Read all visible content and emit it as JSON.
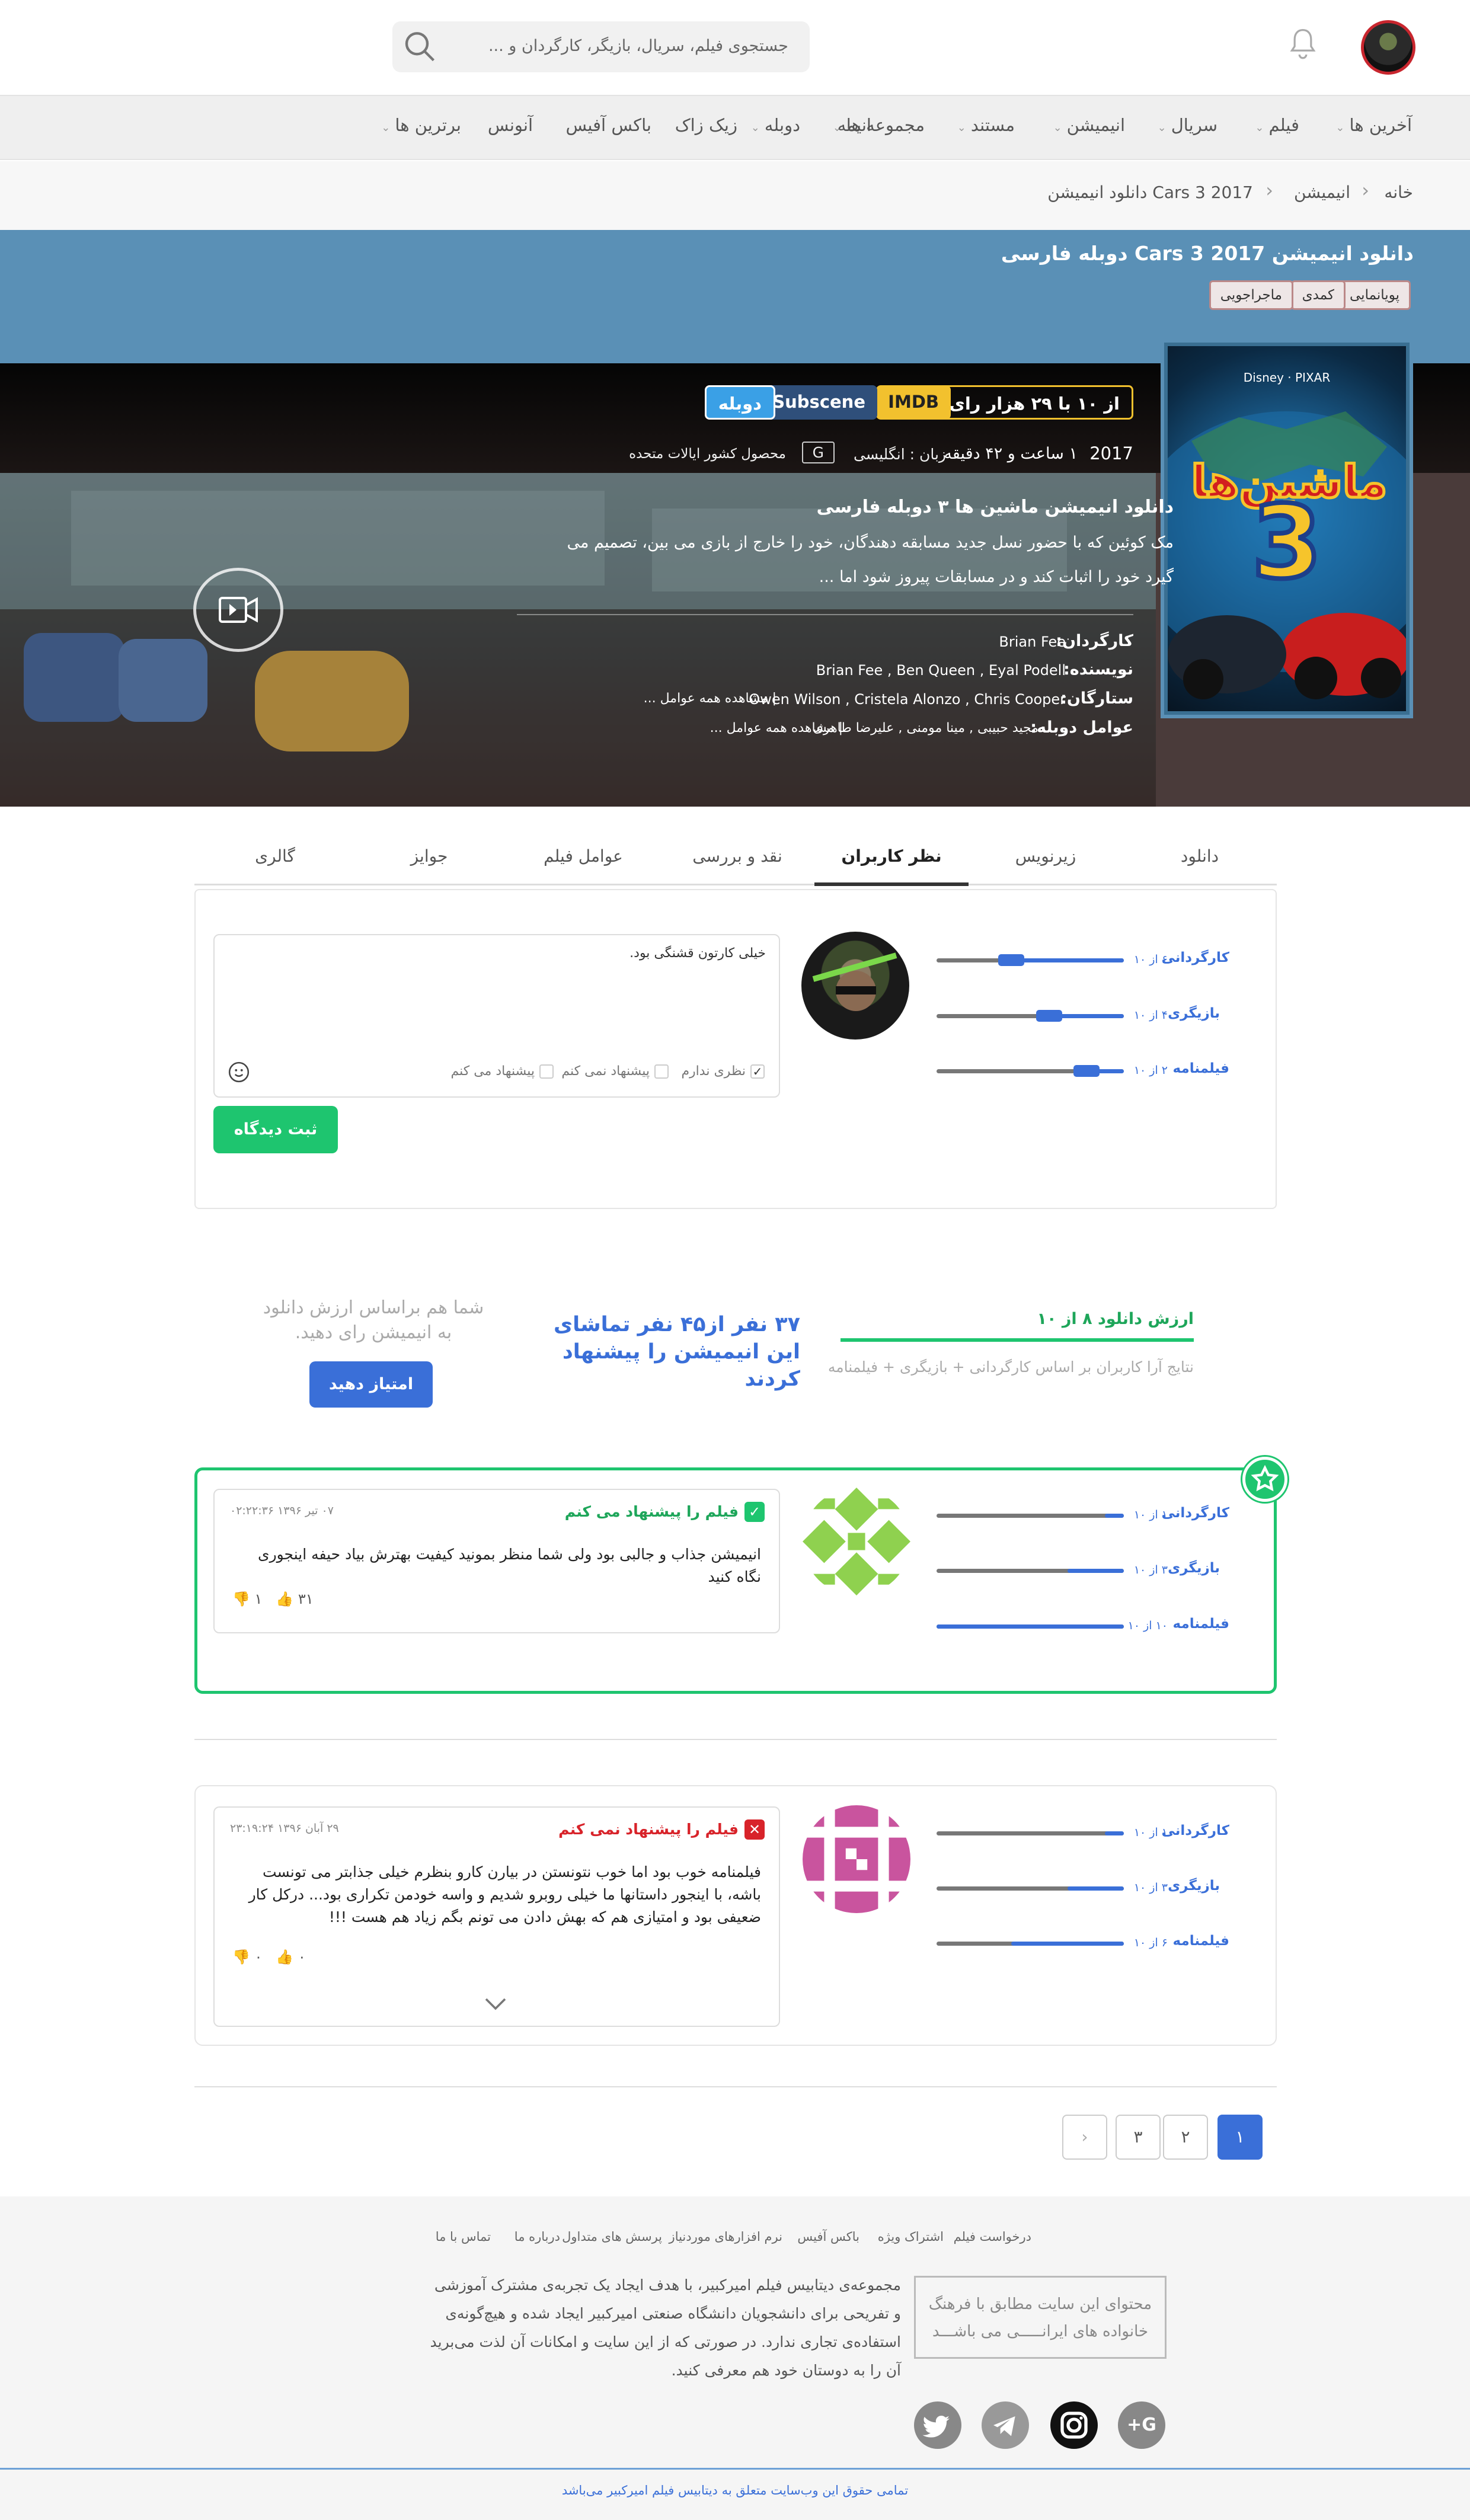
{
  "header": {
    "search_placeholder": "جستجوی فیلم، سریال، بازیگر، کارگردان و ..."
  },
  "nav": [
    {
      "label": "آخرین ها",
      "dropdown": true
    },
    {
      "label": "فیلم",
      "dropdown": true
    },
    {
      "label": "سریال",
      "dropdown": true
    },
    {
      "label": "انیمیشن",
      "dropdown": true
    },
    {
      "label": "مستند",
      "dropdown": true
    },
    {
      "label": "مجموعه ها",
      "dropdown": true
    },
    {
      "label": "انیمه",
      "dropdown": false
    },
    {
      "label": "دوبله",
      "dropdown": true
    },
    {
      "label": "زیک زاک",
      "dropdown": false
    },
    {
      "label": "باکس آفیس",
      "dropdown": false
    },
    {
      "label": "آنونس",
      "dropdown": false
    },
    {
      "label": "برترین ها",
      "dropdown": true
    }
  ],
  "breadcrumb": [
    "خانه",
    "انیمیشن",
    "دانلود انیمیشن Cars 3 2017"
  ],
  "movie": {
    "title": "دانلود انیمیشن Cars 3 2017  دوبله فارسی",
    "genres": [
      "پویانمایی",
      "کمدی",
      "ماجراجویی"
    ],
    "rating": "۶.۹ از ۱۰ با ۲۹ هزار رای",
    "imdb": "IMDB",
    "subscene": "Subscene",
    "dub": "دوبله",
    "year": "2017",
    "duration": "۱ ساعت و ۴۲ دقیقه",
    "language": "زبان : انگلیسی",
    "age": "G",
    "country": "محصول کشور ایالات متحده",
    "synopsis_title": "دانلود انیمیشن ماشین ها ۳ دوبله فارسی",
    "synopsis_1": "مک کوئین که با حضور نسل جدید مسابقه دهندگان، خود را خارج از بازی می بین، تصمیم می",
    "synopsis_2": "گیرد خود را اثبات کند و در مسابقات پیروز شود اما ...",
    "director_label": "کارگردان:",
    "director": "Brian Fee",
    "writer_label": "نویسنده:",
    "writers": "Brian Fee ,  Ben Queen ,  Eyal Podell",
    "stars_label": "ستارگان:",
    "stars": "Owen Wilson ,  Cristela Alonzo ,  Chris Cooper",
    "stars_more": "مشاهده همه عوامل ...",
    "dub_label": "عوامل دوبله:",
    "dub_crew": "مجید حبیبی ,  مینا مومنی ,  علیرضا طاهری",
    "dub_more": "مشاهده همه عوامل ...",
    "poster_title": "ماشین‌ها",
    "poster_num": "3",
    "poster_brand": "Disney · PIXAR"
  },
  "tabs": [
    "دانلود",
    "زیرنویس",
    "نظر کاربران",
    "نقد و بررسی",
    "عوامل فیلم",
    "جوایز",
    "گالری"
  ],
  "rating_form": {
    "labels": [
      "کارگردانی",
      "بازیگری",
      "فیلمنامه"
    ],
    "scores": [
      "۶ از ۱۰",
      "۴ از ۱۰",
      "۲ از ۱۰"
    ],
    "values": [
      6,
      4,
      2
    ],
    "comment": "خیلی کارتون قشنگی بود.",
    "opt_none": "نظری ندارم",
    "opt_no": "پیشنهاد نمی کنم",
    "opt_yes": "پیشنهاد می کنم",
    "submit": "ثبت دیدگاه"
  },
  "summary": {
    "title": "ارزش دانلود ۸ از ۱۰",
    "subtitle": "نتایج آرا کاربران بر اساس کارگردانی + بازیگری + فیلمنامه",
    "recommend": "۳۷ نفر از۴۵ نفر تماشای این انیمیشن را پیشنهاد کردند",
    "ask": "شما هم براساس ارزش دانلود به انیمیشن رای دهید.",
    "button": "امتیاز دهید"
  },
  "reviews": [
    {
      "verdict": "فیلم را پیشنهاد می کنم",
      "date": "۰۷ تیر ۱۳۹۶ ۰۲:۲۲:۳۶",
      "text": "انیمیشن جذاب و جالبی بود ولی شما منظر بمونید کیفیت بهترش بیاد حیفه اینجوری نگاه کنید",
      "likes": "۳۱",
      "dislikes": "۱",
      "scores": [
        "۱ از ۱۰",
        "۳ از ۱۰",
        "۱۰ از ۱۰"
      ],
      "values": [
        1,
        3,
        10
      ]
    },
    {
      "verdict": "فیلم را پیشنهاد نمی کنم",
      "date": "۲۹ آبان ۱۳۹۶ ۲۳:۱۹:۲۴",
      "text": "فیلمنامه خوب بود اما خوب نتونستن در بیارن کارو بنظرم خیلی جذابتر می تونست باشه، با اینجور داستانها ما خیلی روبرو شدیم و واسه خودمن تکراری بود... درکل کار ضعیفی بود و امتیازی هم که بهش دادن می تونم بگم زیاد هم هست !!!",
      "likes": "۰",
      "dislikes": "۰",
      "scores": [
        "۱ از ۱۰",
        "۳ از ۱۰",
        "۶ از ۱۰"
      ],
      "values": [
        1,
        3,
        6
      ]
    }
  ],
  "pagination": [
    "۱",
    "۲",
    "۳"
  ],
  "footer": {
    "links": [
      "درخواست فیلم",
      "اشتراک ویژه",
      "باکس آفیس",
      "نرم افزارهای موردنیاز",
      "پرسش های متداول",
      "درباره ما",
      "تماس با ما"
    ],
    "description": "مجموعه‌ی دیتابیس فیلم امیرکبیر، با هدف ایجاد یک تجربه‌ی مشترک آموزشی و تفریحی برای دانشجویان دانشگاه صنعتی امیرکبیر ایجاد شده و هیچ‌گونه‌ی استفاده‌ی تجاری ندارد. در صورتی که از این سایت و امکانات آن لذت می‌برید آن را به دوستان خود هم معرفی کنید.",
    "badge": "محتوای این سایت مطابق با فرهنگ خانواده های ایرانـــــی می باشـــد",
    "social": [
      "G+",
      "instagram",
      "telegram",
      "twitter"
    ],
    "copyright": "تمامی حقوق این وب‌سایت متعلق به دیتابیس فیلم امیرکبیر می‌باشد"
  },
  "colors": {
    "accent": "#3a6fd8",
    "green": "#1ec56f",
    "red": "#d8232a",
    "hero_blue": "#5a90b6",
    "imdb_yellow": "#f2c12e",
    "subscene_blue": "#2f4f7a",
    "dub_blue": "#3aa0e6"
  }
}
